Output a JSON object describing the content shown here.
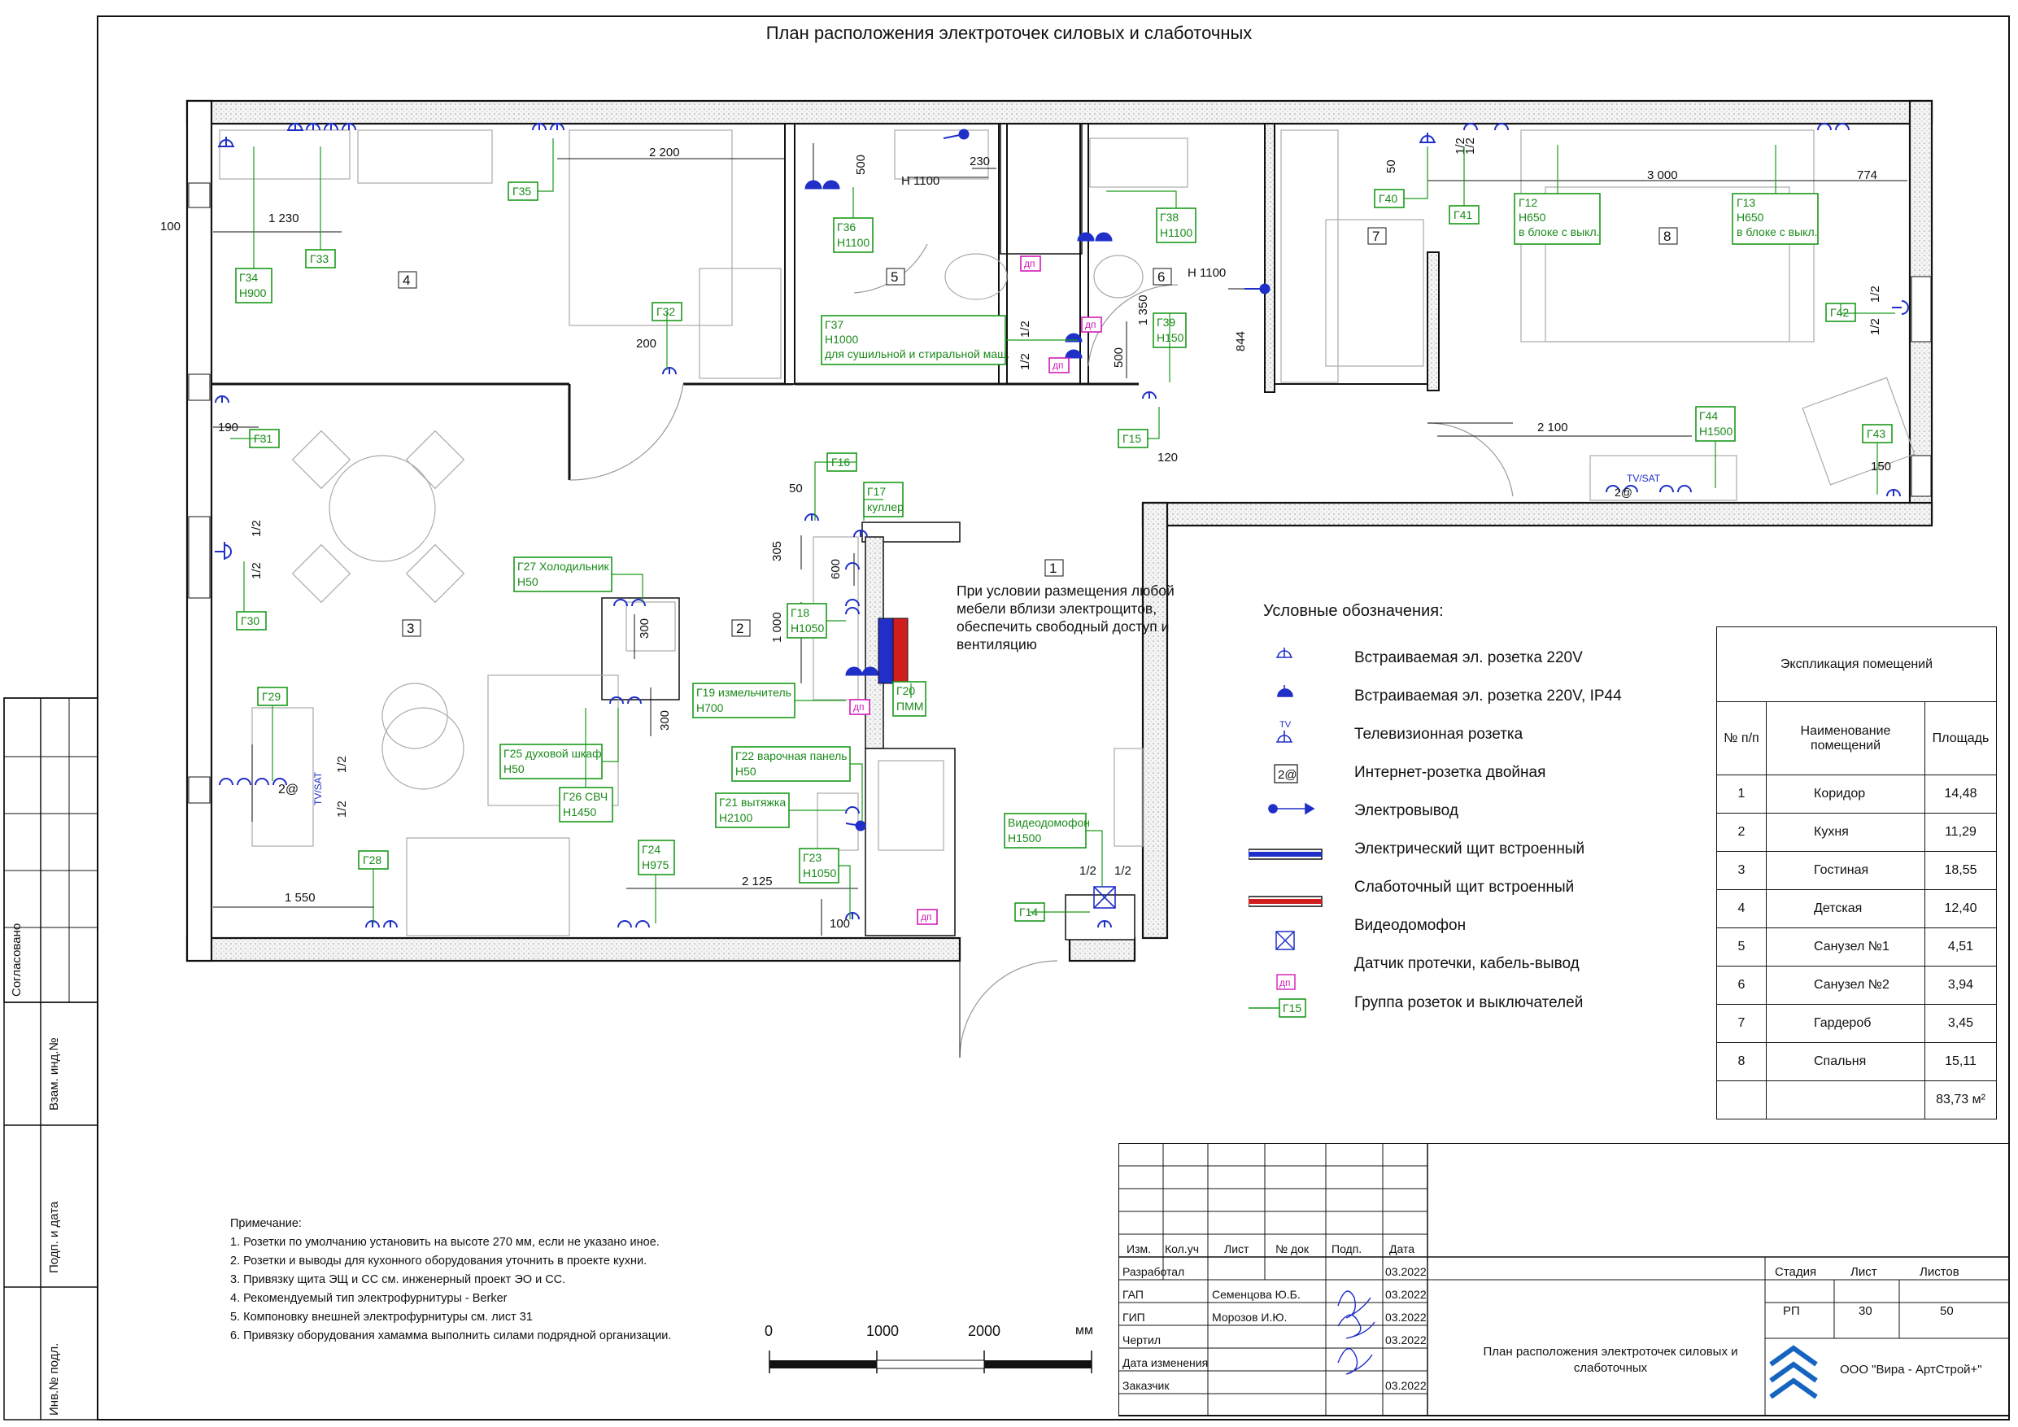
{
  "page": {
    "title": "План расположения электроточек силовых и слаботочных"
  },
  "side_stamp": {
    "agreed": "Согласовано",
    "ref_no": "Взам. инд.№",
    "sign_date": "Подп. и дата",
    "inv_no": "Инв.№ подл."
  },
  "rooms": [
    {
      "num": "1"
    },
    {
      "num": "2"
    },
    {
      "num": "3"
    },
    {
      "num": "4"
    },
    {
      "num": "5"
    },
    {
      "num": "6"
    },
    {
      "num": "7"
    },
    {
      "num": "8"
    }
  ],
  "groups": {
    "g12": [
      "Г12",
      "Н650",
      "в блоке с выкл."
    ],
    "g13": [
      "Г13",
      "Н650",
      "в блоке с выкл."
    ],
    "g14": [
      "Г14"
    ],
    "g15": [
      "Г15"
    ],
    "g16": [
      "Г16"
    ],
    "g17": [
      "Г17",
      "куллер"
    ],
    "g18": [
      "Г18",
      "Н1050"
    ],
    "g19": [
      "Г19 измельчитель",
      "Н700"
    ],
    "g20": [
      "Г20",
      "ПММ"
    ],
    "g21": [
      "Г21 вытяжка",
      "Н2100"
    ],
    "g22": [
      "Г22 варочная панель",
      "Н50"
    ],
    "g23": [
      "Г23",
      "Н1050"
    ],
    "g24": [
      "Г24",
      "Н975"
    ],
    "g25": [
      "Г25 духовой шкаф",
      "Н50"
    ],
    "g26": [
      "Г26 СВЧ",
      "Н1450"
    ],
    "g27": [
      "Г27 Холодильник",
      "Н50"
    ],
    "g28": [
      "Г28"
    ],
    "g29": [
      "Г29"
    ],
    "g30": [
      "Г30"
    ],
    "g31": [
      "Г31"
    ],
    "g32": [
      "Г32"
    ],
    "g33": [
      "Г33"
    ],
    "g34": [
      "Г34",
      "Н900"
    ],
    "g35": [
      "Г35"
    ],
    "g36": [
      "Г36",
      "Н1100"
    ],
    "g37": [
      "Г37",
      "Н1000",
      "для сушильной и стиральной маш."
    ],
    "g38": [
      "Г38",
      "Н1100"
    ],
    "g39": [
      "Г39",
      "Н150"
    ],
    "g40": [
      "Г40"
    ],
    "g41": [
      "Г41"
    ],
    "g42": [
      "Г42"
    ],
    "g43": [
      "Г43"
    ],
    "g44": [
      "Г44",
      "Н1500"
    ],
    "intercom": [
      "Видеодомофон",
      "Н1500"
    ]
  },
  "dims": {
    "d2200a": "2 200",
    "d1230": "1 230",
    "d100a": "100",
    "d200": "200",
    "d190": "190",
    "d1550": "1 550",
    "d2125": "2 125",
    "d100b": "100",
    "d50a": "50",
    "d305": "305",
    "d600": "600",
    "d1000": "1 000",
    "d300a": "300",
    "d300b": "300",
    "d500a": "500",
    "d230": "230",
    "h1100a": "Н 1100",
    "h1100b": "Н 1100",
    "d1350": "1 350",
    "d500b": "500",
    "d844": "844",
    "d120": "120",
    "d50b": "50",
    "d3000": "3 000",
    "d774": "774",
    "d2100": "2 100",
    "d150": "150",
    "half": "1/2",
    "tvsat": "TV/SAT",
    "net": "2@",
    "dp": "дп"
  },
  "panel_note": [
    "При условии размещения любой",
    "мебели вблизи электрощитов,",
    "обеспечить свободный доступ и",
    "вентиляцию"
  ],
  "legend": {
    "heading": "Условные обозначения:",
    "items": [
      "Встраиваемая эл. розетка 220V",
      "Встраиваемая эл. розетка 220V, IP44",
      "Телевизионная розетка",
      "Интернет-розетка двойная",
      "Электровывод",
      "Электрический щит встроенный",
      "Слаботочный щит встроенный",
      "Видеодомофон",
      "Датчик протечки, кабель-вывод",
      "Группа розеток и выключателей"
    ],
    "sym_tv": "TV",
    "sym_net": "2@",
    "sym_dp": "дп",
    "sym_group": "Г15"
  },
  "explication": {
    "title": "Экспликация помещений",
    "headers": [
      "№ п/п",
      "Наименование помещений",
      "Площадь"
    ],
    "rows": [
      [
        "1",
        "Коридор",
        "14,48"
      ],
      [
        "2",
        "Кухня",
        "11,29"
      ],
      [
        "3",
        "Гостиная",
        "18,55"
      ],
      [
        "4",
        "Детская",
        "12,40"
      ],
      [
        "5",
        "Санузел №1",
        "4,51"
      ],
      [
        "6",
        "Санузел №2",
        "3,94"
      ],
      [
        "7",
        "Гардероб",
        "3,45"
      ],
      [
        "8",
        "Спальня",
        "15,11"
      ]
    ],
    "total": "83,73 м²"
  },
  "notes": {
    "heading": "Примечание:",
    "items": [
      "1. Розетки по умолчанию установить на высоте 270 мм, если не указано иное.",
      "2. Розетки и выводы для кухонного оборудования уточнить в проекте кухни.",
      "3. Привязку щита ЭЩ и СС см. инженерный проект ЭО и СС.",
      "4. Рекомендуемый тип электрофурнитуры - Berker",
      "5. Компоновку внешней электрофурнитуры см. лист 31",
      "6. Привязку оборудования хамамма выполнить силами подрядной организации."
    ]
  },
  "scale": {
    "l0": "0",
    "l1": "1000",
    "l2": "2000",
    "unit": "мм"
  },
  "stamp": {
    "headers": [
      "Изм.",
      "Кол.уч",
      "Лист",
      "№ док",
      "Подп.",
      "Дата"
    ],
    "rows": [
      [
        "Разработал",
        "",
        "03.2022"
      ],
      [
        "ГАП",
        "Семенцова Ю.Б.",
        "03.2022"
      ],
      [
        "ГИП",
        "Морозов И.Ю.",
        "03.2022"
      ],
      [
        "Чертил",
        "",
        "03.2022"
      ],
      [
        "Дата изменения",
        "",
        ""
      ],
      [
        "Заказчик",
        "",
        "03.2022"
      ]
    ],
    "sheet_title": "План расположения электроточек силовых и слаботочных",
    "stage_label": "Стадия",
    "sheet_label": "Лист",
    "sheets_label": "Листов",
    "stage": "РП",
    "sheet": "30",
    "sheets": "50",
    "company": "ООО \"Вира - АртСтрой+\""
  }
}
